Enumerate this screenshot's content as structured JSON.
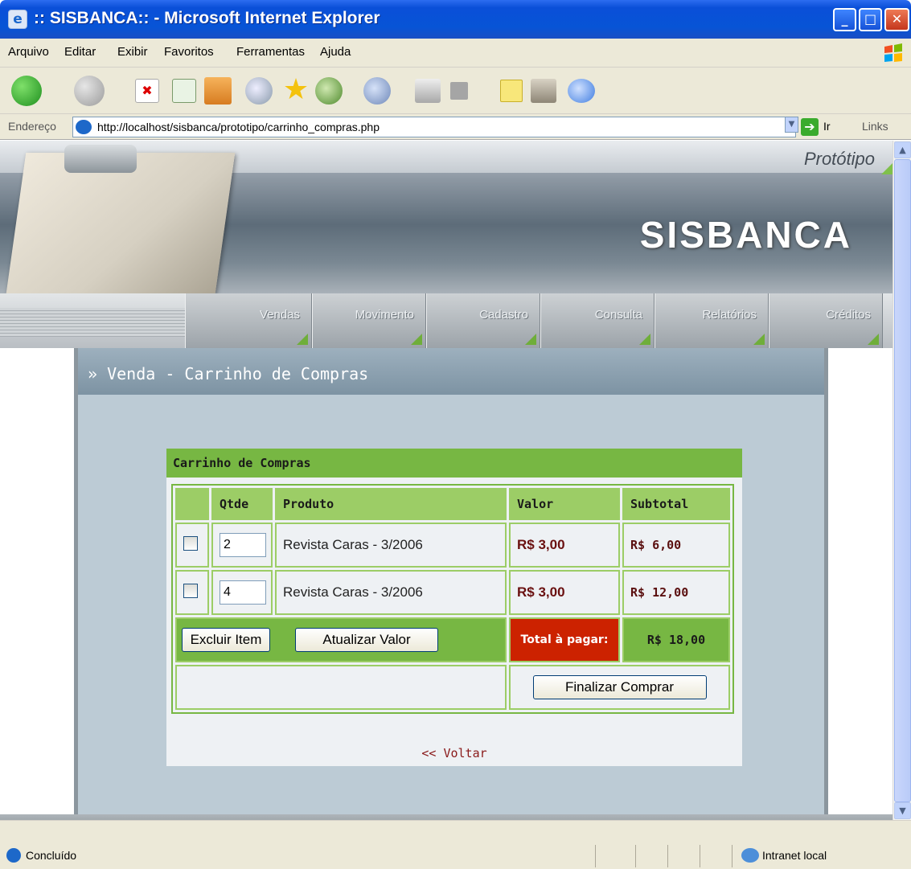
{
  "window": {
    "title": ":: SISBANCA:: - Microsoft Internet Explorer"
  },
  "menu": {
    "items": [
      "Arquivo",
      "Editar",
      "Exibir",
      "Favoritos",
      "Ferramentas",
      "Ajuda"
    ]
  },
  "address": {
    "label": "Endereço",
    "url": "http://localhost/sisbanca/prototipo/carrinho_compras.php",
    "go_label": "Ir",
    "links_label": "Links"
  },
  "header": {
    "tag": "Protótipo",
    "brand": "SISBANCA"
  },
  "nav": {
    "tabs": [
      "Vendas",
      "Movimento",
      "Cadastro",
      "Consulta",
      "Relatórios",
      "Créditos"
    ]
  },
  "panel": {
    "title": "Venda - Carrinho de Compras"
  },
  "cart": {
    "title": "Carrinho de Compras",
    "columns": [
      "Qtde",
      "Produto",
      "Valor",
      "Subtotal"
    ],
    "rows": [
      {
        "qty": "2",
        "product": "Revista Caras - 3/2006",
        "price": "R$ 3,00",
        "subtotal": "R$ 6,00"
      },
      {
        "qty": "4",
        "product": "Revista Caras - 3/2006",
        "price": "R$ 3,00",
        "subtotal": "R$ 12,00"
      }
    ],
    "delete_label": "Excluir Item",
    "update_label": "Atualizar Valor",
    "total_label": "Total à pagar:",
    "total_value": "R$ 18,00",
    "finish_label": "Finalizar Comprar",
    "back_label": "<< Voltar"
  },
  "status": {
    "text": "Concluído",
    "zone": "Intranet local"
  },
  "colors": {
    "accent_green": "#77b743",
    "total_red": "#cc2200",
    "xp_blue": "#0754d6"
  }
}
